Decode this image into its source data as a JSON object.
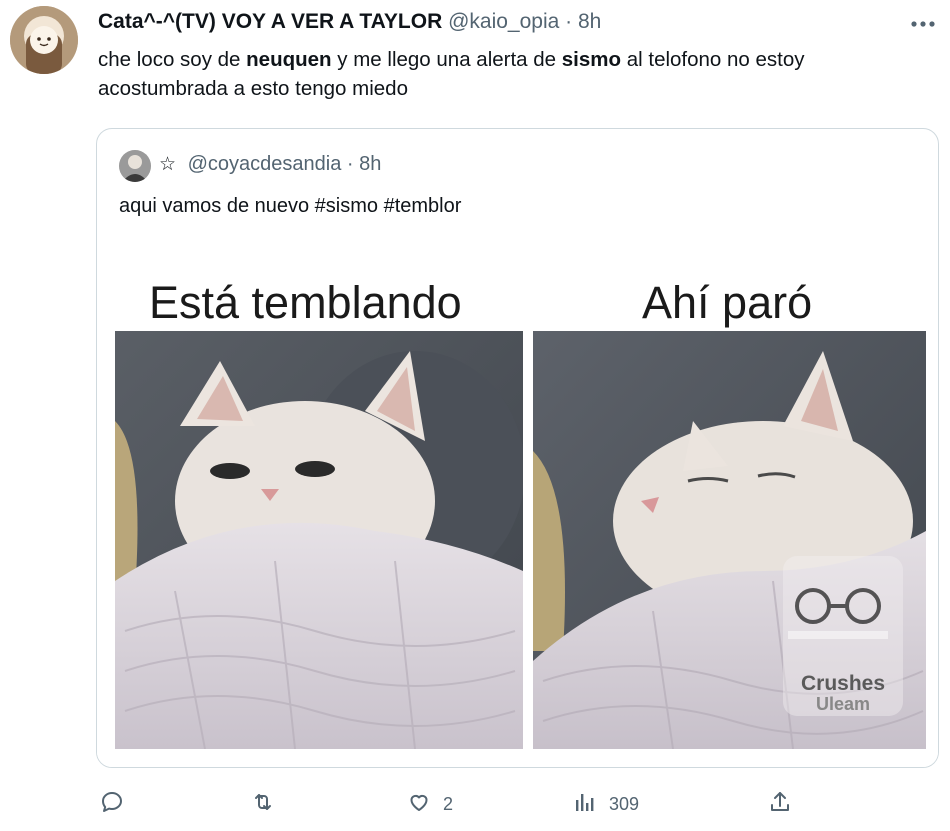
{
  "tweet": {
    "display_name": "Cata^-^(TV) VOY A VER A TAYLOR",
    "handle": "@kaio_opia",
    "separator": "·",
    "time": "8h",
    "more_icon": "more-dots-icon",
    "text_parts": [
      {
        "t": "che loco soy de ",
        "b": false
      },
      {
        "t": "neuquen",
        "b": true
      },
      {
        "t": " y me llego una alerta de ",
        "b": false
      },
      {
        "t": "sismo",
        "b": true
      },
      {
        "t": " al telofono no estoy acostumbrada a esto tengo miedo",
        "b": false
      }
    ]
  },
  "quote": {
    "star": "☆",
    "handle": "@coyacdesandia",
    "separator": "·",
    "time": "8h",
    "text": "aqui vamos de nuevo #sismo #temblor",
    "meme": {
      "left_caption": "Está temblando",
      "right_caption": "Ahí paró",
      "watermark_line1": "Crushes",
      "watermark_line2": "Uleam"
    }
  },
  "actions": {
    "reply": {
      "icon": "reply-icon",
      "count": ""
    },
    "retweet": {
      "icon": "retweet-icon",
      "count": ""
    },
    "like": {
      "icon": "heart-icon",
      "count": "2"
    },
    "views": {
      "icon": "views-chart-icon",
      "count": "309"
    },
    "share": {
      "icon": "share-icon",
      "count": ""
    }
  }
}
